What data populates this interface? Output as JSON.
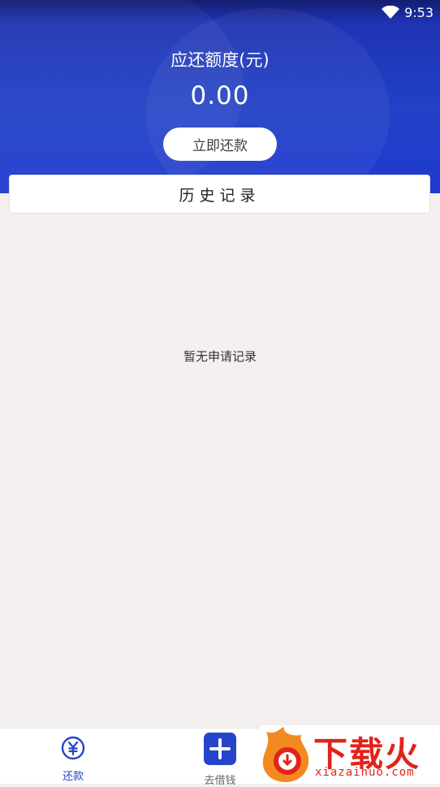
{
  "status_bar": {
    "time": "9:53"
  },
  "header": {
    "title": "应还额度(元)",
    "amount": "0.00",
    "repay_button": "立即还款"
  },
  "history": {
    "title": "历史记录",
    "empty_text": "暂无申请记录"
  },
  "tabbar": {
    "items": [
      {
        "label": "还款",
        "icon": "yen-circle-icon",
        "active": true
      },
      {
        "label": "去借钱",
        "icon": "plus-square-icon",
        "active": false
      }
    ]
  },
  "watermark": {
    "brand": "下载火",
    "url": "xiazaihuo.com"
  },
  "colors": {
    "primary": "#2141c6",
    "background": "#f3f0ef",
    "watermark": "#e2231a"
  }
}
